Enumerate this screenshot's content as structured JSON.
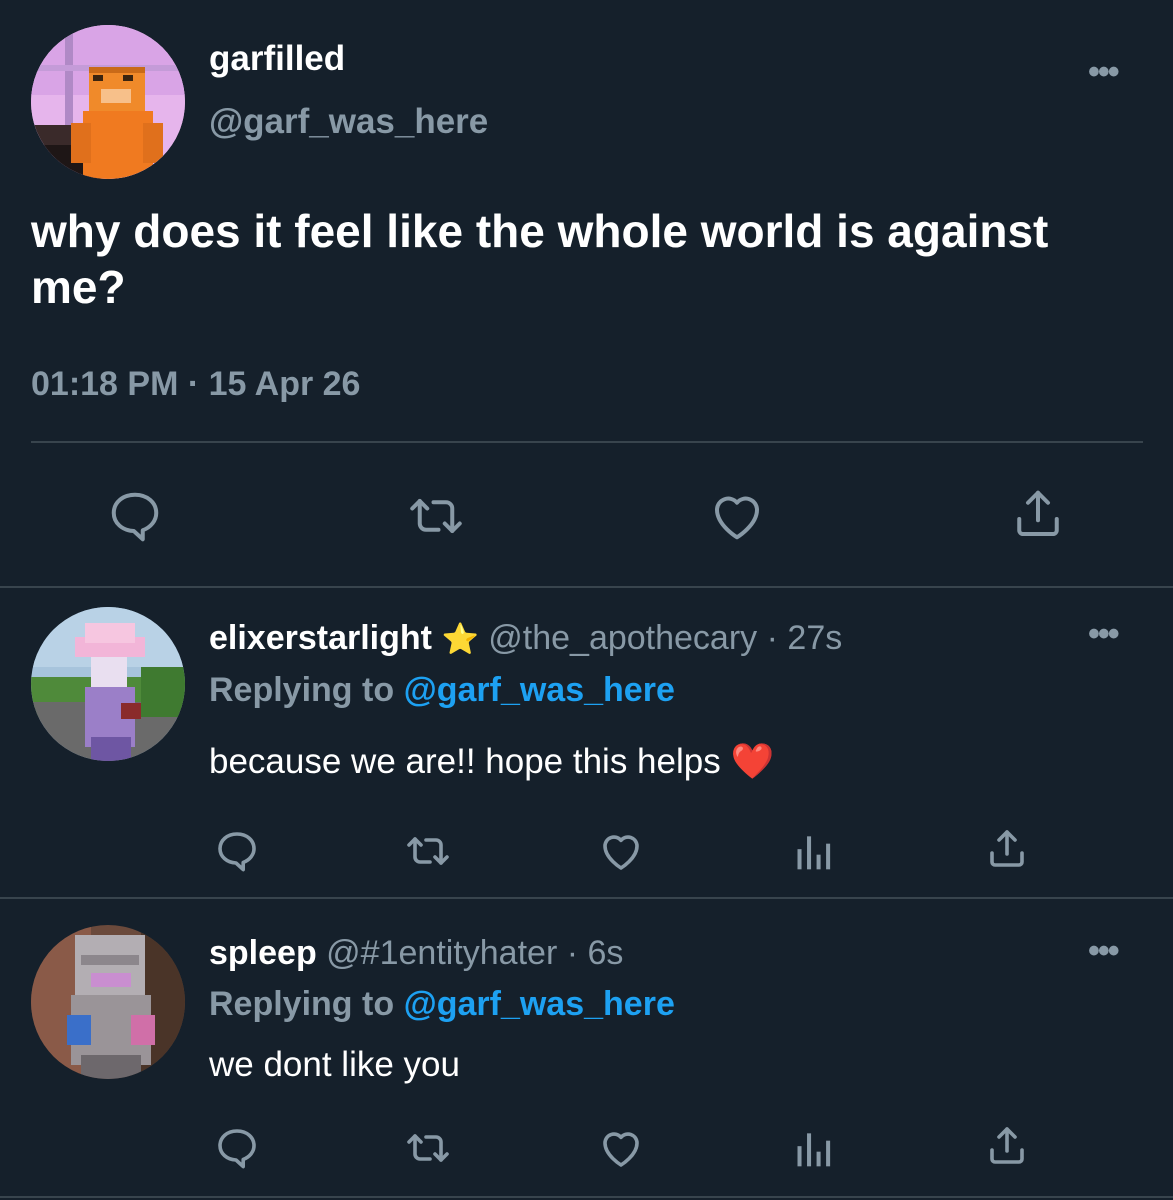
{
  "main_tweet": {
    "display_name": "garfilled",
    "handle": "@garf_was_here",
    "text": "why does it feel like the whole world is against me?",
    "time": "01:18 PM",
    "separator": "·",
    "date": "15 Apr 26",
    "more_label": "•••",
    "actions": [
      "reply-icon",
      "retweet-icon",
      "like-icon",
      "share-icon"
    ]
  },
  "replies": [
    {
      "display_name": "elixerstarlight",
      "name_emoji": "⭐",
      "handle": "@the_apothecary",
      "separator": "·",
      "age": "27s",
      "replying_prefix": "Replying to",
      "replying_to": "@garf_was_here",
      "text": "because we are!! hope this helps",
      "text_emoji": "❤️",
      "more_label": "•••"
    },
    {
      "display_name": "spleep",
      "handle": "@#1entityhater",
      "separator": "·",
      "age": "6s",
      "replying_prefix": "Replying to",
      "replying_to": "@garf_was_here",
      "text": "we dont like you",
      "more_label": "•••"
    }
  ],
  "colors": {
    "background": "#15202b",
    "muted": "#8899a6",
    "link": "#1da1f2",
    "divider": "#38444d"
  }
}
